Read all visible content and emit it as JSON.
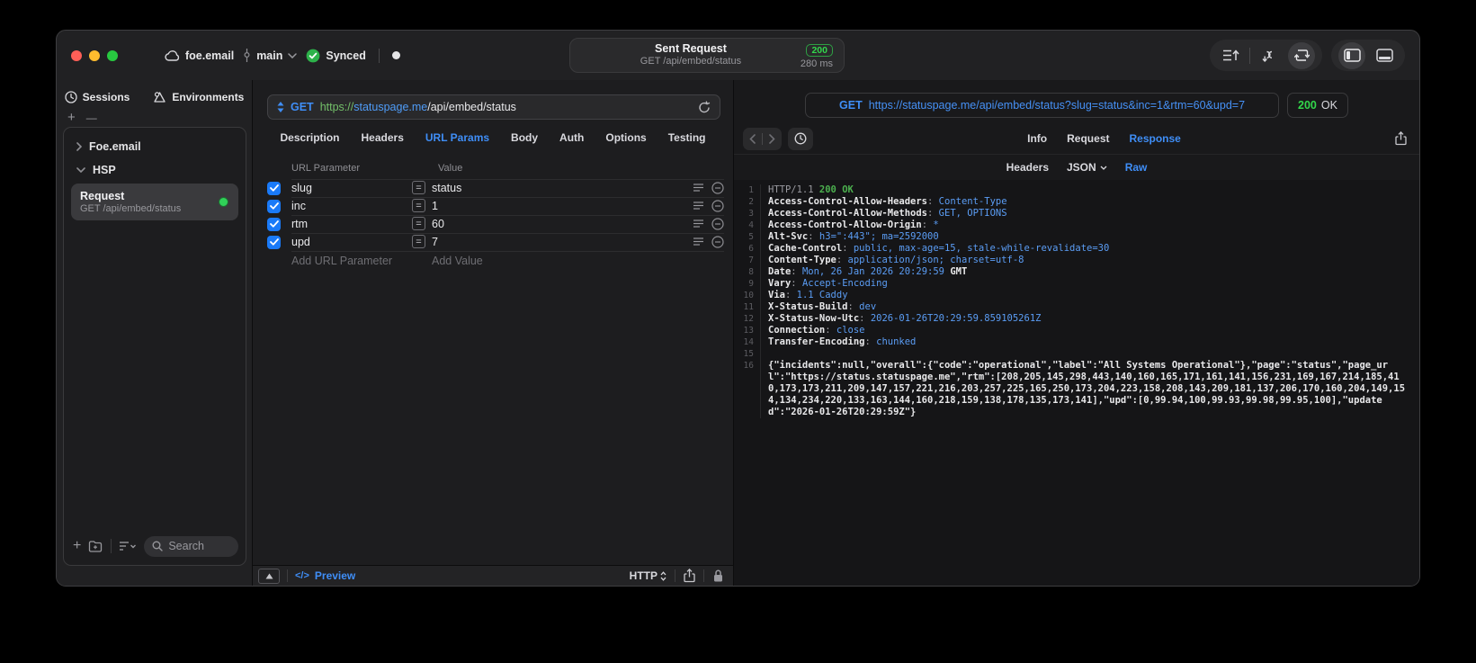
{
  "titlebar": {
    "project": "foe.email",
    "branch": "main",
    "sync_status": "Synced",
    "request_title": "Sent Request",
    "request_subtitle": "GET /api/embed/status",
    "status_code": "200",
    "duration": "280 ms"
  },
  "sidebar": {
    "tabs": [
      "Sessions",
      "Environments"
    ],
    "groups": [
      "Foe.email",
      "HSP"
    ],
    "request_item": {
      "title": "Request",
      "subtitle": "GET /api/embed/status"
    },
    "search_placeholder": "Search"
  },
  "request_pane": {
    "method": "GET",
    "url": {
      "scheme": "https://",
      "host": "statuspage.me",
      "path": "/api/embed/status"
    },
    "tabs": [
      "Description",
      "Headers",
      "URL Params",
      "Body",
      "Auth",
      "Options",
      "Testing"
    ],
    "active_tab": "URL Params",
    "params": {
      "columns": [
        "URL Parameter",
        "Value"
      ],
      "operator": "=",
      "rows": [
        {
          "name": "slug",
          "value": "status",
          "enabled": true
        },
        {
          "name": "inc",
          "value": "1",
          "enabled": true
        },
        {
          "name": "rtm",
          "value": "60",
          "enabled": true
        },
        {
          "name": "upd",
          "value": "7",
          "enabled": true
        }
      ],
      "add_name": "Add URL Parameter",
      "add_value": "Add Value"
    },
    "footer": {
      "code_glyph": "</>",
      "preview": "Preview",
      "protocol": "HTTP"
    }
  },
  "response_pane": {
    "method": "GET",
    "url": "https://statuspage.me/api/embed/status?slug=status&inc=1&rtm=60&upd=7",
    "status": {
      "code": "200",
      "text": "OK"
    },
    "tabs": [
      "Info",
      "Request",
      "Response"
    ],
    "active_tab": "Response",
    "subtabs": [
      "Headers",
      "JSON",
      "Raw"
    ],
    "active_subtab": "Raw",
    "body_lines": [
      {
        "n": 1,
        "segments": [
          {
            "style": "muted",
            "text": "HTTP/1.1 "
          },
          {
            "style": "green",
            "text": "200 OK"
          }
        ]
      },
      {
        "n": 2,
        "segments": [
          {
            "style": "name",
            "text": "Access-Control-Allow-Headers"
          },
          {
            "style": "muted",
            "text": ": "
          },
          {
            "style": "value",
            "text": "Content-Type"
          }
        ]
      },
      {
        "n": 3,
        "segments": [
          {
            "style": "name",
            "text": "Access-Control-Allow-Methods"
          },
          {
            "style": "muted",
            "text": ": "
          },
          {
            "style": "value",
            "text": "GET, OPTIONS"
          }
        ]
      },
      {
        "n": 4,
        "segments": [
          {
            "style": "name",
            "text": "Access-Control-Allow-Origin"
          },
          {
            "style": "muted",
            "text": ": "
          },
          {
            "style": "value",
            "text": "*"
          }
        ]
      },
      {
        "n": 5,
        "segments": [
          {
            "style": "name",
            "text": "Alt-Svc"
          },
          {
            "style": "muted",
            "text": ": "
          },
          {
            "style": "value",
            "text": "h3=\":443\"; ma=2592000"
          }
        ]
      },
      {
        "n": 6,
        "segments": [
          {
            "style": "name",
            "text": "Cache-Control"
          },
          {
            "style": "muted",
            "text": ": "
          },
          {
            "style": "value",
            "text": "public, max-age=15, stale-while-revalidate=30"
          }
        ]
      },
      {
        "n": 7,
        "segments": [
          {
            "style": "name",
            "text": "Content-Type"
          },
          {
            "style": "muted",
            "text": ": "
          },
          {
            "style": "value",
            "text": "application/json; charset=utf-8"
          }
        ]
      },
      {
        "n": 8,
        "segments": [
          {
            "style": "name",
            "text": "Date"
          },
          {
            "style": "muted",
            "text": ": "
          },
          {
            "style": "value",
            "text": "Mon, 26 Jan 2026 20:29:59 "
          },
          {
            "style": "name",
            "text": "GMT"
          }
        ]
      },
      {
        "n": 9,
        "segments": [
          {
            "style": "name",
            "text": "Vary"
          },
          {
            "style": "muted",
            "text": ": "
          },
          {
            "style": "value",
            "text": "Accept-Encoding"
          }
        ]
      },
      {
        "n": 10,
        "segments": [
          {
            "style": "name",
            "text": "Via"
          },
          {
            "style": "muted",
            "text": ": "
          },
          {
            "style": "value",
            "text": "1.1 Caddy"
          }
        ]
      },
      {
        "n": 11,
        "segments": [
          {
            "style": "name",
            "text": "X-Status-Build"
          },
          {
            "style": "muted",
            "text": ": "
          },
          {
            "style": "value",
            "text": "dev"
          }
        ]
      },
      {
        "n": 12,
        "segments": [
          {
            "style": "name",
            "text": "X-Status-Now-Utc"
          },
          {
            "style": "muted",
            "text": ": "
          },
          {
            "style": "value",
            "text": "2026-01-26T20:29:59.859105261Z"
          }
        ]
      },
      {
        "n": 13,
        "segments": [
          {
            "style": "name",
            "text": "Connection"
          },
          {
            "style": "muted",
            "text": ": "
          },
          {
            "style": "value",
            "text": "close"
          }
        ]
      },
      {
        "n": 14,
        "segments": [
          {
            "style": "name",
            "text": "Transfer-Encoding"
          },
          {
            "style": "muted",
            "text": ": "
          },
          {
            "style": "value",
            "text": "chunked"
          }
        ]
      },
      {
        "n": 15,
        "segments": []
      },
      {
        "n": 16,
        "segments": [
          {
            "style": "body",
            "text": "{\"incidents\":null,\"overall\":{\"code\":\"operational\",\"label\":\"All Systems Operational\"},\"page\":\"status\",\"page_url\":\"https://status.statuspage.me\",\"rtm\":[208,205,145,298,443,140,160,165,171,161,141,156,231,169,167,214,185,410,173,173,211,209,147,157,221,216,203,257,225,165,250,173,204,223,158,208,143,209,181,137,206,170,160,204,149,154,134,234,220,133,163,144,160,218,159,138,178,135,173,141],\"upd\":[0,99.94,100,99.93,99.98,99.95,100],\"updated\":\"2026-01-26T20:29:59Z\"}"
          }
        ]
      }
    ]
  },
  "colors": {
    "accent": "#0a84ff",
    "green": "#32d74b",
    "value_blue": "#5b9df5",
    "scheme_green": "#73bf69"
  }
}
